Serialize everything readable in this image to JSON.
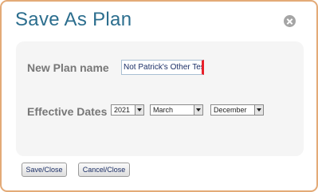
{
  "dialog": {
    "title": "Save As Plan",
    "close_icon": "close-icon"
  },
  "form": {
    "plan_name_label": "New Plan name",
    "plan_name_value": "Not Patrick's Other Tes",
    "effective_dates_label": "Effective Dates",
    "year": "2021",
    "start_month": "March",
    "end_month": "December"
  },
  "buttons": {
    "save_close": "Save/Close",
    "cancel_close": "Cancel/Close"
  },
  "colors": {
    "title": "#2c6e8e",
    "border": "#e3aa77",
    "cursor": "#e8202a"
  }
}
